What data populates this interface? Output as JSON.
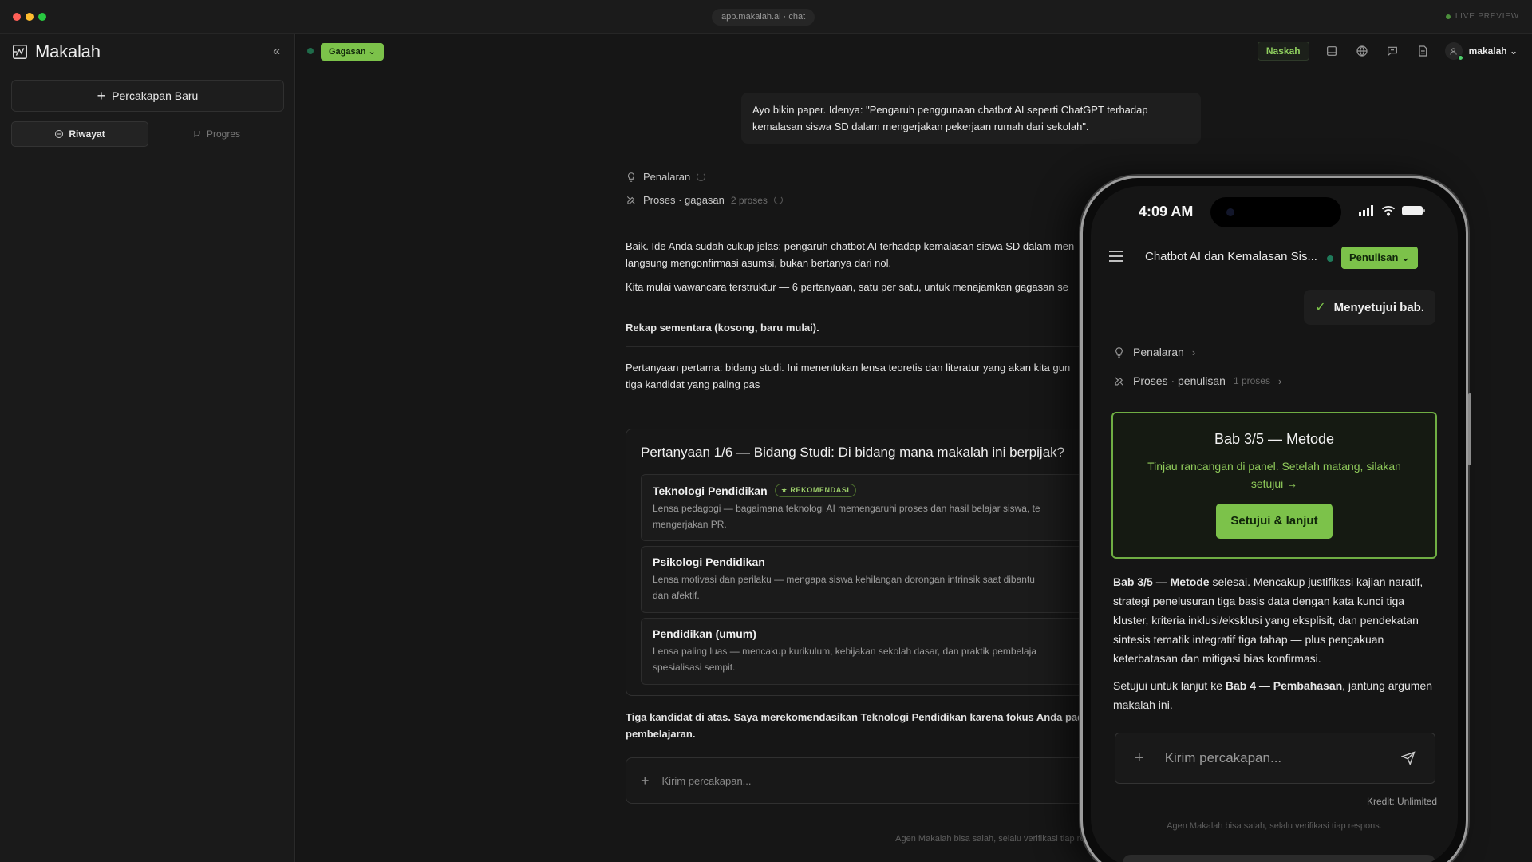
{
  "window": {
    "url": "app.makalah.ai · chat",
    "live_preview": "LIVE PREVIEW"
  },
  "sidebar": {
    "brand": "Makalah",
    "collapse_icon": "«",
    "new_chat_label": "Percakapan Baru",
    "tabs": [
      {
        "label": "Riwayat",
        "active": true
      },
      {
        "label": "Progres",
        "active": false
      }
    ]
  },
  "header": {
    "mode_label": "Gagasan ⌄",
    "naskah_label": "Naskah",
    "user_name": "makalah ⌄"
  },
  "chat": {
    "user_message": "Ayo bikin paper. Idenya: \"Pengaruh penggunaan chatbot AI seperti ChatGPT terhadap kemalasan siswa SD dalam mengerjakan pekerjaan rumah dari sekolah\".",
    "reasoning_label": "Penalaran",
    "process_label": "Proses · gagasan",
    "process_count": "2 proses",
    "p1": "Baik. Ide Anda sudah cukup jelas: pengaruh chatbot AI terhadap kemalasan siswa SD dalam men",
    "p1b": "langsung mengonfirmasi asumsi, bukan bertanya dari nol.",
    "p2": "Kita mulai wawancara terstruktur — 6 pertanyaan, satu per satu, untuk menajamkan gagasan se",
    "p3": "Rekap sementara (kosong, baru mulai).",
    "p4": "Pertanyaan pertama: bidang studi. Ini menentukan lensa teoretis dan literatur yang akan kita gun",
    "p4b": "tiga kandidat yang paling pas",
    "question_title": "Pertanyaan 1/6 — Bidang Studi: Di bidang mana makalah ini berpijak?",
    "options": [
      {
        "title": "Teknologi Pendidikan",
        "badge": "★ REKOMENDASI",
        "desc": "Lensa pedagogi — bagaimana teknologi AI memengaruhi proses dan hasil belajar siswa, te\nmengerjakan PR."
      },
      {
        "title": "Psikologi Pendidikan",
        "badge": "",
        "desc": "Lensa motivasi dan perilaku — mengapa siswa kehilangan dorongan intrinsik saat dibantu\ndan afektif."
      },
      {
        "title": "Pendidikan (umum)",
        "badge": "",
        "desc": "Lensa paling luas — mencakup kurikulum, kebijakan sekolah dasar, dan praktik pembelaja\nspesialisasi sempit."
      }
    ],
    "p5": "Tiga kandidat di atas. Saya merekomendasikan Teknologi Pendidikan karena fokus Anda pada ad",
    "p5b": "pembelajaran.",
    "composer_placeholder": "Kirim percakapan...",
    "disclaimer": "Agen Makalah bisa salah, selalu verifikasi tiap respons."
  },
  "phone": {
    "time": "4:09 AM",
    "title": "Chatbot AI dan Kemalasan Sis...",
    "mode_label": "Penulisan ⌄",
    "approve_label": "Menyetujui bab.",
    "reasoning_label": "Penalaran",
    "process_label": "Proses · penulisan",
    "process_count": "1 proses",
    "card_title": "Bab 3/5 — Metode",
    "card_sub": "Tinjau rancangan di panel. Setelah matang, silakan setujui →",
    "card_button": "Setujui & lanjut",
    "para1_bold": "Bab 3/5 — Metode",
    "para1_rest": " selesai. Mencakup justifikasi kajian naratif, strategi penelusuran tiga basis data dengan kata kunci tiga kluster, kriteria inklusi/eksklusi yang eksplisit, dan pendekatan sintesis tematik integratif tiga tahap — plus pengakuan keterbatasan dan mitigasi bias konfirmasi.",
    "para2_a": "Setujui untuk lanjut ke ",
    "para2_bold": "Bab 4 — Pembahasan",
    "para2_b": ", jantung argumen makalah ini.",
    "composer_placeholder": "Kirim percakapan...",
    "kredit": "Kredit: Unlimited",
    "disclaimer": "Agen Makalah bisa salah, selalu verifikasi tiap respons."
  },
  "colors": {
    "accent": "#7cc24a",
    "background": "#161616",
    "sidebar": "#1a1a1a"
  }
}
